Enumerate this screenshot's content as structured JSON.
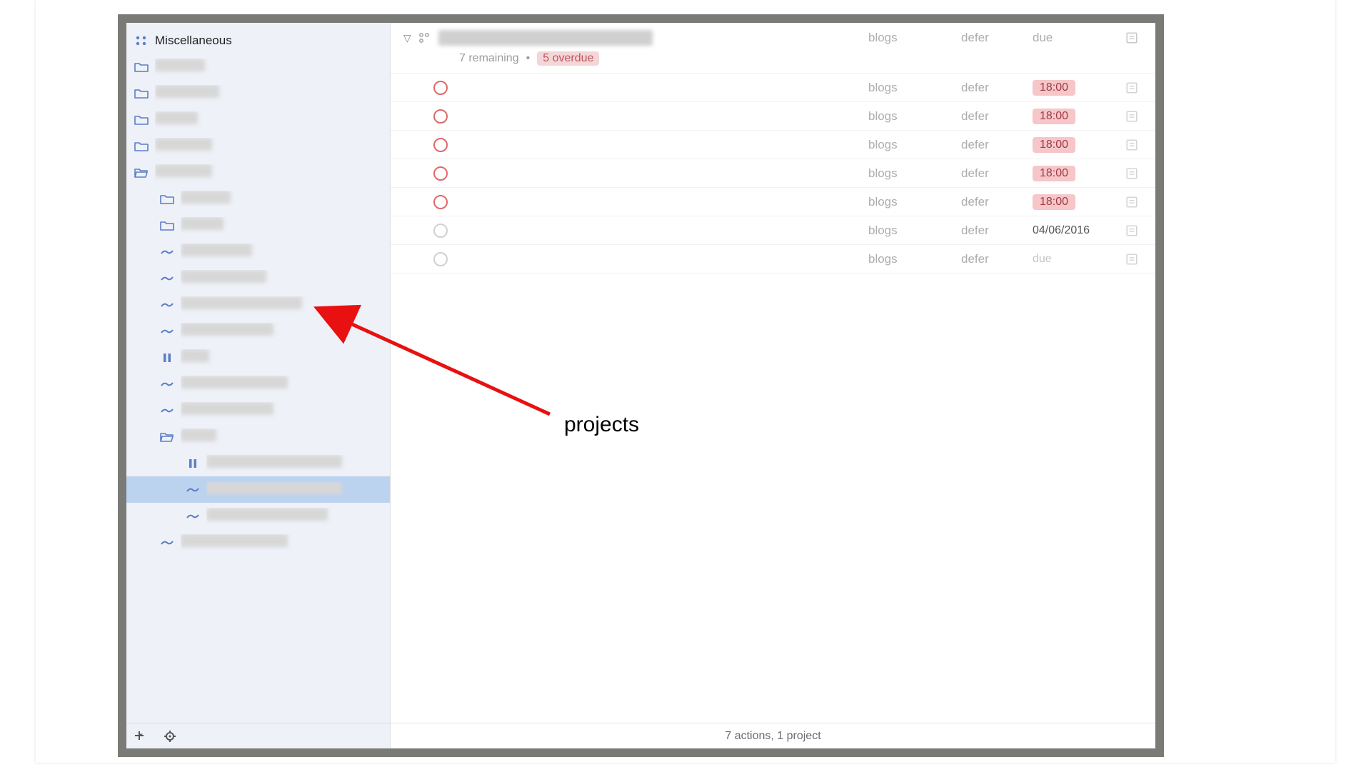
{
  "sidebar": {
    "perspective_label": "Miscellaneous",
    "items": [
      {
        "type": "perspective",
        "level": 0
      },
      {
        "type": "folder",
        "level": 1,
        "selected": false
      },
      {
        "type": "folder",
        "level": 1,
        "selected": false
      },
      {
        "type": "folder",
        "level": 1,
        "selected": false
      },
      {
        "type": "folder",
        "level": 1,
        "selected": false
      },
      {
        "type": "folder-open",
        "level": 1,
        "selected": false
      },
      {
        "type": "folder",
        "level": 2,
        "selected": false
      },
      {
        "type": "folder",
        "level": 2,
        "selected": false
      },
      {
        "type": "project",
        "level": 2,
        "selected": false
      },
      {
        "type": "project",
        "level": 2,
        "selected": false
      },
      {
        "type": "project",
        "level": 2,
        "selected": false
      },
      {
        "type": "project",
        "level": 2,
        "selected": false
      },
      {
        "type": "project-onhold",
        "level": 2,
        "selected": false
      },
      {
        "type": "project",
        "level": 2,
        "selected": false
      },
      {
        "type": "project",
        "level": 2,
        "selected": false
      },
      {
        "type": "folder-open",
        "level": 2,
        "selected": false
      },
      {
        "type": "project-onhold",
        "level": 3,
        "selected": false
      },
      {
        "type": "project",
        "level": 3,
        "selected": true
      },
      {
        "type": "project",
        "level": 3,
        "selected": false
      },
      {
        "type": "project",
        "level": 2,
        "selected": false
      }
    ]
  },
  "header": {
    "columns": {
      "context": "blogs",
      "defer": "defer",
      "due": "due"
    },
    "remaining_text": "7 remaining",
    "overdue_text": "5 overdue"
  },
  "tasks": [
    {
      "circle": "red",
      "context": "blogs",
      "defer": "defer",
      "due": "18:00",
      "due_overdue": true,
      "title_w": 230
    },
    {
      "circle": "red",
      "context": "blogs",
      "defer": "defer",
      "due": "18:00",
      "due_overdue": true,
      "title_w": 420
    },
    {
      "circle": "red",
      "context": "blogs",
      "defer": "defer",
      "due": "18:00",
      "due_overdue": true,
      "title_w": 210
    },
    {
      "circle": "red",
      "context": "blogs",
      "defer": "defer",
      "due": "18:00",
      "due_overdue": true,
      "title_w": 200
    },
    {
      "circle": "red",
      "context": "blogs",
      "defer": "defer",
      "due": "18:00",
      "due_overdue": true,
      "title_w": 270
    },
    {
      "circle": "gray",
      "context": "blogs",
      "defer": "defer",
      "due": "04/06/2016",
      "due_overdue": false,
      "title_w": 150
    },
    {
      "circle": "gray",
      "context": "blogs",
      "defer": "defer",
      "due": "due",
      "due_overdue": false,
      "title_w": 180
    }
  ],
  "status": {
    "text": "7 actions, 1 project"
  },
  "annotation": {
    "label": "projects"
  }
}
